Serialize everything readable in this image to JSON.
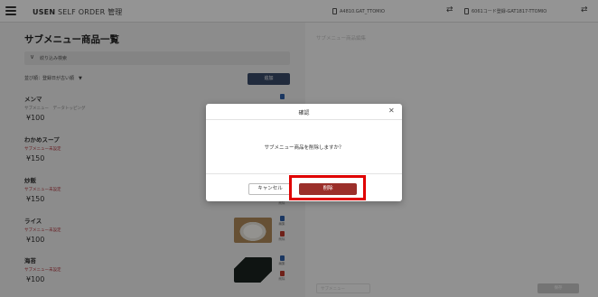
{
  "header": {
    "app_title_bold": "USEN",
    "app_title_rest": " SELF ORDER 管理",
    "pos_1": "A4810.GAT_TTOMIO",
    "pos_2": "6061コード登録-GAT1817-TTOMIO",
    "swap_glyph": "⇄"
  },
  "page": {
    "title": "サブメニュー商品一覧",
    "filter_label": "絞り込み検索",
    "chevron_glyph": "∨",
    "sort_label": "並び順：登録日が古い順　▼",
    "add_button": "追加"
  },
  "actions": {
    "edit": "編集",
    "delete": "削除"
  },
  "items": [
    {
      "name": "メンマ",
      "sub": "サブメニュー　データトッピング",
      "price": "¥100",
      "sub_color": "gray"
    },
    {
      "name": "わかめスープ",
      "sub": "サブメニュー未設定",
      "price": "¥150",
      "sub_color": "red"
    },
    {
      "name": "炒飯",
      "sub": "サブメニュー未設定",
      "price": "¥150",
      "sub_color": "red"
    },
    {
      "name": "ライス",
      "sub": "サブメニュー未設定",
      "price": "¥100",
      "sub_color": "red",
      "image": "rice"
    },
    {
      "name": "海苔",
      "sub": "サブメニュー未設定",
      "price": "¥100",
      "sub_color": "red",
      "image": "nori"
    }
  ],
  "right_panel": {
    "title": "サブメニュー商品編集",
    "bottom_input": "サブメニュー",
    "bottom_button": "保存"
  },
  "dialog": {
    "title": "確認",
    "close_glyph": "✕",
    "message": "サブメニュー商品を削除しますか？",
    "cancel": "キャンセル",
    "delete": "削除"
  },
  "colors": {
    "accent_navy": "#3a4a6a",
    "delete_red": "#9b2f2a",
    "highlight_red": "#e00000",
    "warning_text": "#b3333b"
  }
}
